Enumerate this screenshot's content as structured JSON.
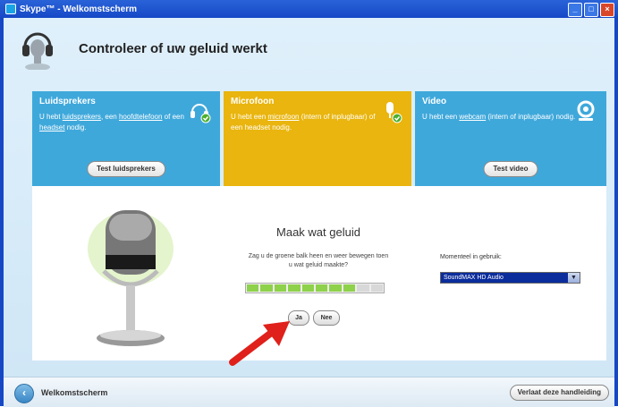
{
  "window": {
    "title": "Skype™ - Welkomstscherm"
  },
  "page": {
    "title": "Controleer of uw geluid werkt"
  },
  "panels": {
    "speakers": {
      "title": "Luidsprekers",
      "text_pre": "U hebt ",
      "link1": "luidsprekers",
      "text_mid1": ", een ",
      "link2": "hoofdtelefoon",
      "text_mid2": " of een ",
      "link3": "headset",
      "text_post": " nodig.",
      "button": "Test luidsprekers",
      "icon": "headset-check-icon"
    },
    "microphone": {
      "title": "Microfoon",
      "text_pre": "U hebt een ",
      "link1": "microfoon",
      "text_post": " (intern of inplugbaar) of een headset nodig.",
      "icon": "microphone-check-icon"
    },
    "video": {
      "title": "Video",
      "text_pre": "U hebt een ",
      "link1": "webcam",
      "text_post": " (intern of inplugbaar) nodig.",
      "button": "Test video",
      "icon": "webcam-icon"
    }
  },
  "sound_test": {
    "title": "Maak wat geluid",
    "question": "Zag u de groene balk heen en weer bewegen toen u wat geluid maakte?",
    "yes_label": "Ja",
    "no_label": "Nee",
    "meter_level": 0.8,
    "meter_segments": 10
  },
  "device": {
    "label": "Momenteel in gebruik:",
    "selected": "SoundMAX HD Audio"
  },
  "footer": {
    "back_label": "Welkomstscherm",
    "exit_label": "Verlaat deze handleiding"
  },
  "colors": {
    "panel_blue": "#3fa8db",
    "panel_active": "#e9b50e",
    "meter_green": "#8ed14a"
  }
}
